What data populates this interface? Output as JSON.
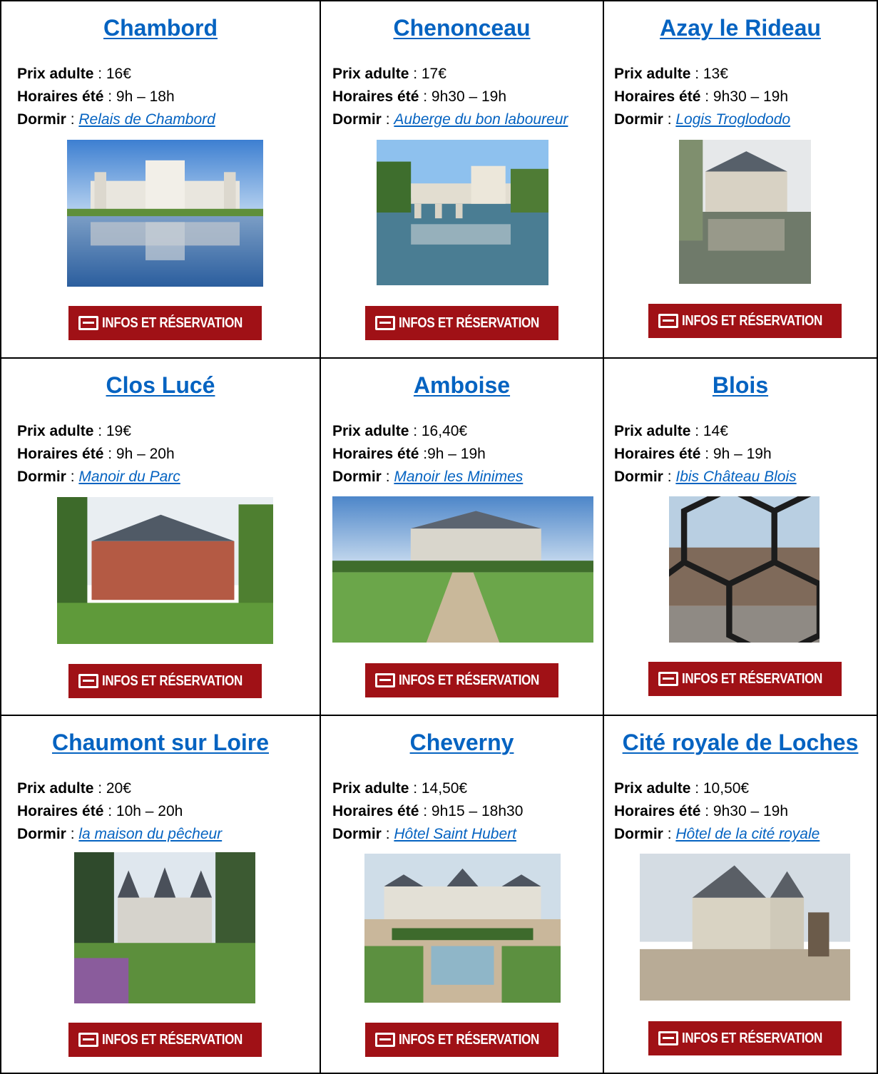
{
  "labels": {
    "prix": "Prix adulte",
    "horaires": "Horaires été",
    "dormir": "Dormir"
  },
  "button_label": "INFOS ET RÉSERVATION",
  "colors": {
    "link": "#0563C1",
    "button": "#A01116"
  },
  "castles": [
    {
      "name": "Chambord",
      "prix": " : 16€",
      "horaires": " : 9h – 18h",
      "dormir": "Relais de Chambord"
    },
    {
      "name": "Chenonceau",
      "prix": " : 17€",
      "horaires": " : 9h30 – 19h",
      "dormir": "Auberge du bon laboureur"
    },
    {
      "name": "Azay le Rideau",
      "prix": " : 13€",
      "horaires": " : 9h30 – 19h",
      "dormir": "Logis Troglododo"
    },
    {
      "name": "Clos Lucé",
      "prix": " : 19€",
      "horaires": " : 9h – 20h",
      "dormir": "Manoir du Parc"
    },
    {
      "name": "Amboise",
      "prix": " : 16,40€",
      "horaires": " :9h – 19h",
      "dormir": "Manoir les Minimes"
    },
    {
      "name": "Blois",
      "prix": " : 14€",
      "horaires": " : 9h – 19h",
      "dormir": "Ibis Château Blois"
    },
    {
      "name": "Chaumont sur Loire",
      "prix": " : 20€",
      "horaires": " : 10h – 20h",
      "dormir": "la maison du pêcheur"
    },
    {
      "name": "Cheverny",
      "prix": " : 14,50€",
      "horaires": " : 9h15 – 18h30",
      "dormir": "Hôtel Saint Hubert"
    },
    {
      "name": "Cité royale de Loches",
      "prix": " : 10,50€",
      "horaires": " : 9h30 – 19h",
      "dormir": "Hôtel de la cité royale"
    }
  ]
}
